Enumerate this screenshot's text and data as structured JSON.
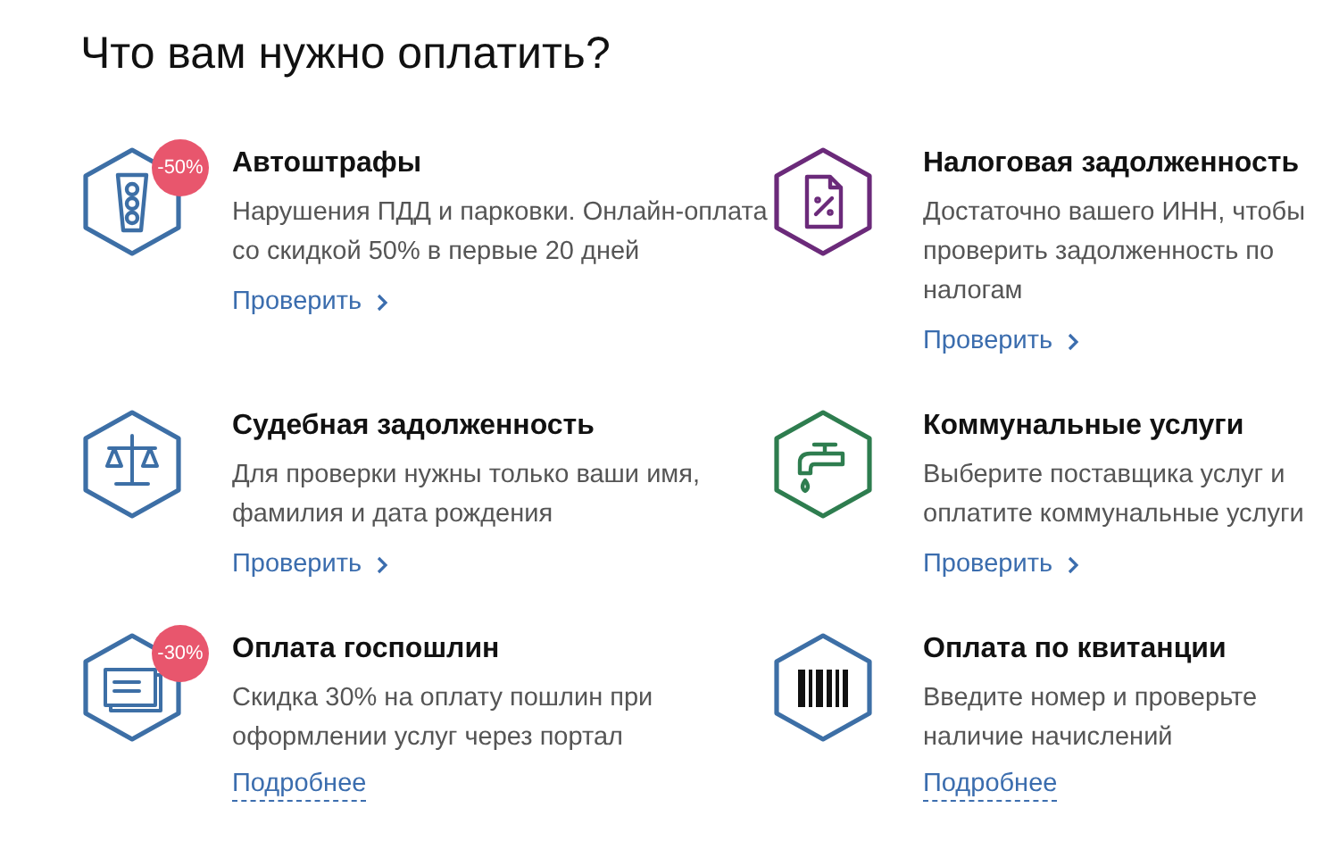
{
  "heading": "Что вам нужно оплатить?",
  "services": [
    {
      "kind": "fines",
      "color": "#3d6fa6",
      "badge": "-50%",
      "title": "Автоштрафы",
      "description": "Нарушения ПДД и парковки. Онлайн-оплата со скидкой 50% в первые 20 дней",
      "link": {
        "kind": "check",
        "text": "Проверить"
      }
    },
    {
      "kind": "tax",
      "color": "#6b2a7a",
      "title": "Налоговая задолженность",
      "description": "Достаточно вашего ИНН, чтобы проверить задолженность по налогам",
      "link": {
        "kind": "check",
        "text": "Проверить"
      }
    },
    {
      "kind": "court",
      "color": "#3d6fa6",
      "title": "Судебная задолженность",
      "description": "Для проверки нужны только ваши имя, фамилия и дата рождения",
      "link": {
        "kind": "check",
        "text": "Проверить"
      }
    },
    {
      "kind": "utilities",
      "color": "#2e7d4f",
      "title": "Коммунальные услуги",
      "description": "Выберите поставщика услуг и оплатите коммунальные услуги",
      "link": {
        "kind": "check",
        "text": "Проверить"
      }
    },
    {
      "kind": "duty",
      "color": "#3d6fa6",
      "badge": "-30%",
      "title": "Оплата госпошлин",
      "description": "Скидка 30% на оплату пошлин при оформлении услуг через портал",
      "link": {
        "kind": "more",
        "text": "Подробнее"
      }
    },
    {
      "kind": "receipt",
      "color": "#3d6fa6",
      "title": "Оплата по квитанции",
      "description": "Введите номер и проверьте наличие начислений",
      "link": {
        "kind": "more",
        "text": "Подробнее"
      }
    }
  ]
}
